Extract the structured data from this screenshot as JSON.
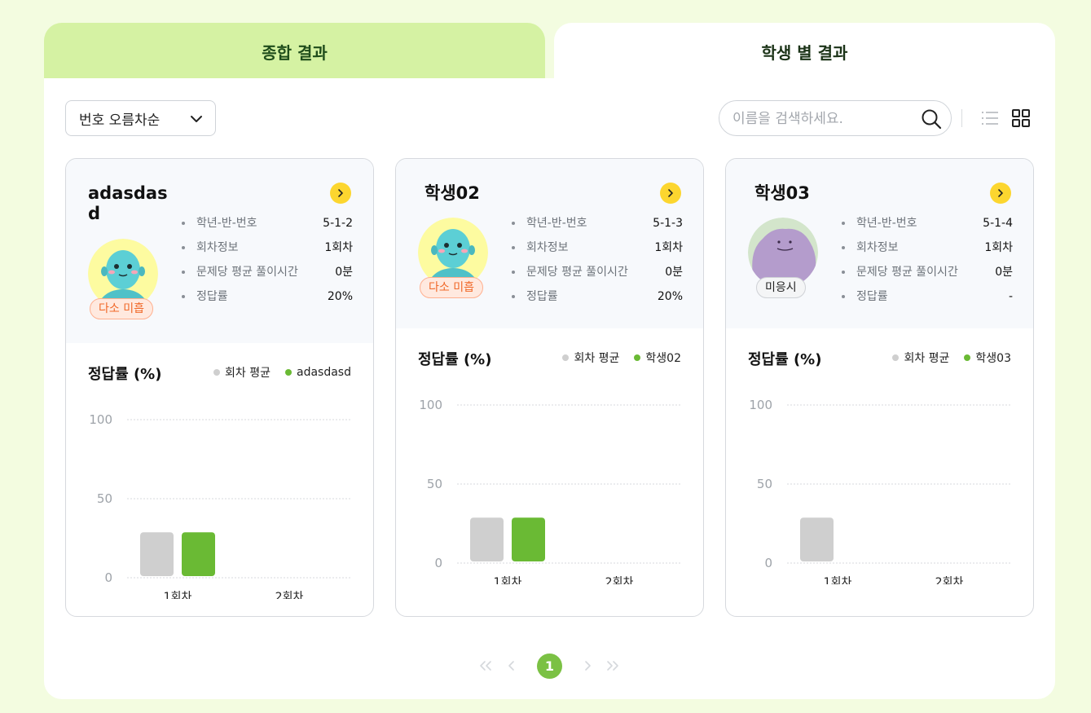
{
  "tabs": [
    {
      "label": "종합 결과"
    },
    {
      "label": "학생 별 결과"
    }
  ],
  "toolbar": {
    "sort_label": "번호 오름차순",
    "search_placeholder": "이름을 검색하세요.",
    "search_value": ""
  },
  "colors": {
    "accent_green": "#6aba34",
    "average_gray": "#cfcfcf",
    "arrow_yellow": "#fcd62f",
    "warn_orange": "#f0692a"
  },
  "info_labels": {
    "grade": "학년-반-번호",
    "session": "회차정보",
    "avg_time": "문제당 평균 풀이시간",
    "accuracy": "정답률"
  },
  "chart_title": "정답률 (%)",
  "legend_avg": "회차 평균",
  "cards": [
    {
      "name": "adasdasd",
      "badge": "다소 미흡",
      "avatar": "blue-monster-icon",
      "grade": "5-1-2",
      "session": "1회차",
      "avg_time": "0분",
      "accuracy": "20%",
      "legend_student": "adasdasd"
    },
    {
      "name": "학생02",
      "badge": "다소 미흡",
      "avatar": "blue-monster-icon",
      "grade": "5-1-3",
      "session": "1회차",
      "avg_time": "0분",
      "accuracy": "20%",
      "legend_student": "학생02"
    },
    {
      "name": "학생03",
      "badge": "미응시",
      "avatar": "purple-blob-icon",
      "grade": "5-1-4",
      "session": "1회차",
      "avg_time": "0분",
      "accuracy": "-",
      "legend_student": "학생03"
    }
  ],
  "chart_data": [
    {
      "type": "bar",
      "title": "정답률 (%)",
      "categories": [
        "1회차",
        "2회차"
      ],
      "series": [
        {
          "name": "회차 평균",
          "values": [
            20,
            null
          ]
        },
        {
          "name": "adasdasd",
          "values": [
            20,
            null
          ]
        }
      ],
      "yticks": [
        0,
        50,
        100
      ],
      "ylim": [
        0,
        100
      ],
      "grid": true,
      "legend": "top-right"
    },
    {
      "type": "bar",
      "title": "정답률 (%)",
      "categories": [
        "1회차",
        "2회차"
      ],
      "series": [
        {
          "name": "회차 평균",
          "values": [
            20,
            null
          ]
        },
        {
          "name": "학생02",
          "values": [
            20,
            null
          ]
        }
      ],
      "yticks": [
        0,
        50,
        100
      ],
      "ylim": [
        0,
        100
      ],
      "grid": true,
      "legend": "top-right"
    },
    {
      "type": "bar",
      "title": "정답률 (%)",
      "categories": [
        "1회차",
        "2회차"
      ],
      "series": [
        {
          "name": "회차 평균",
          "values": [
            20,
            null
          ]
        },
        {
          "name": "학생03",
          "values": [
            null,
            null
          ]
        }
      ],
      "yticks": [
        0,
        50,
        100
      ],
      "ylim": [
        0,
        100
      ],
      "grid": true,
      "legend": "top-right"
    }
  ],
  "pagination": {
    "current": "1",
    "first_icon": "double-chevron-left-icon",
    "prev_icon": "chevron-left-icon",
    "next_icon": "chevron-right-icon",
    "last_icon": "double-chevron-right-icon"
  }
}
